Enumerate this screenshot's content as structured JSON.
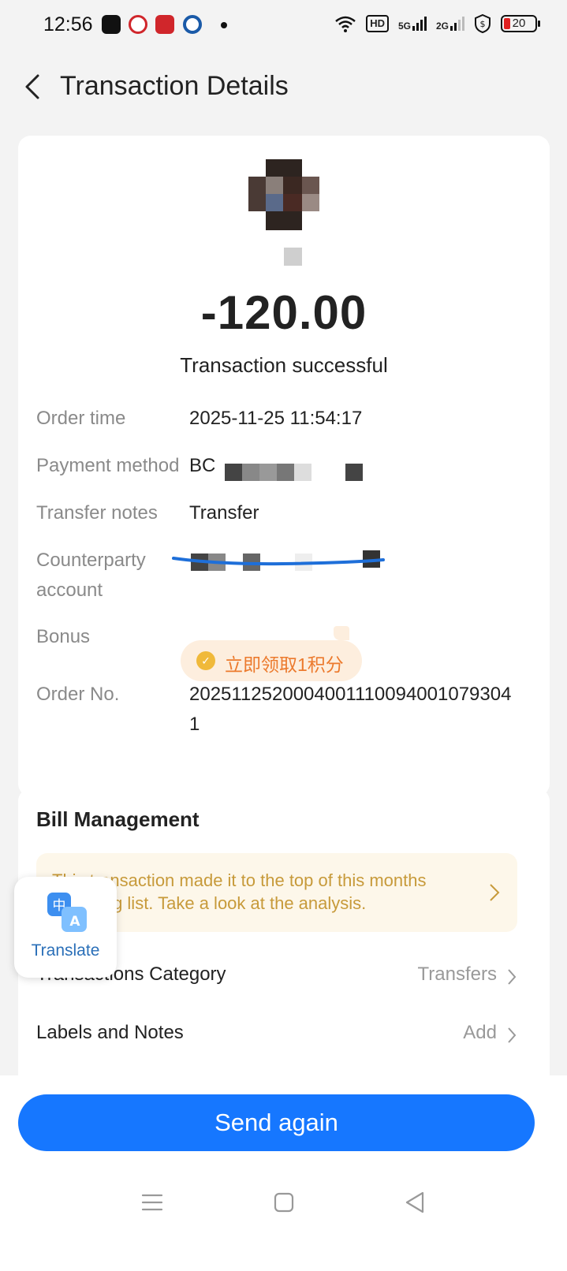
{
  "status_bar": {
    "time": "12:56",
    "hd_label": "HD",
    "net1": "5G",
    "net2": "2G",
    "battery": "20"
  },
  "header": {
    "title": "Transaction Details"
  },
  "summary": {
    "amount": "-120.00",
    "status": "Transaction successful"
  },
  "details": {
    "order_time_label": "Order time",
    "order_time_value": "2025-11-25 11:54:17",
    "payment_method_label": "Payment method",
    "payment_method_value": "BC",
    "transfer_notes_label": "Transfer notes",
    "transfer_notes_value": "Transfer",
    "counterparty_label": "Counterparty account",
    "bonus_label": "Bonus",
    "bonus_chip": "立即领取1积分",
    "order_no_label": "Order No.",
    "order_no_value": "2025112520004001110094001079304 1"
  },
  "bill_management": {
    "title": "Bill Management",
    "notice": "This transaction made it to the top of this months spending list. Take a look at the analysis.",
    "category_label": "Transactions Category",
    "category_value": "Transfers",
    "labels_label": "Labels and Notes",
    "labels_value": "Add"
  },
  "translate": {
    "label": "Translate",
    "icon_glyph_1": "中",
    "icon_glyph_2": "A"
  },
  "actions": {
    "send_again": "Send again"
  },
  "colors": {
    "primary": "#1677ff",
    "bonus_text": "#ec7a2d",
    "notice_text": "#c79a3a"
  }
}
